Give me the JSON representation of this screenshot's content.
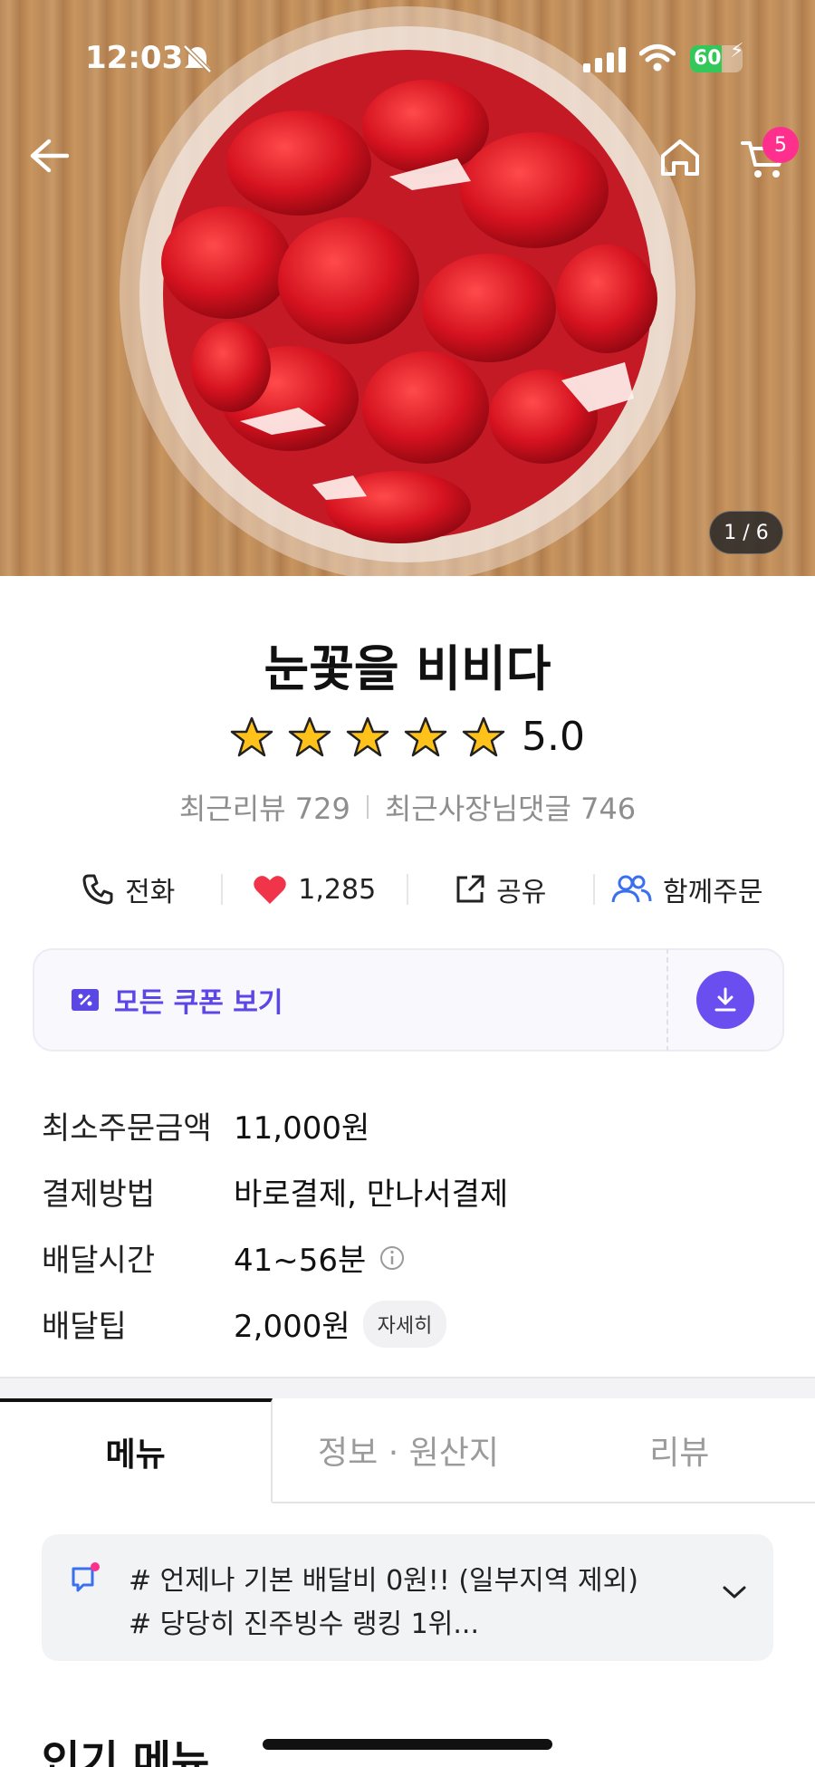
{
  "status_bar": {
    "time": "12:03",
    "battery": "60"
  },
  "hero": {
    "pager": "1 / 6",
    "cart_count": "5"
  },
  "store": {
    "name": "눈꽃을 비비다",
    "rating": "5.0",
    "stars": 5
  },
  "reviews": {
    "recent": "최근리뷰 729",
    "owner": "최근사장님댓글 746"
  },
  "actions": [
    {
      "label": "전화",
      "icon": "phone-icon"
    },
    {
      "label": "1,285",
      "icon": "heart-icon"
    },
    {
      "label": "공유",
      "icon": "share-icon"
    },
    {
      "label": "함께주문",
      "icon": "group-icon"
    }
  ],
  "coupon": {
    "label": "모든 쿠폰 보기"
  },
  "info": {
    "min_order_label": "최소주문금액",
    "min_order_value": "11,000원",
    "payment_label": "결제방법",
    "payment_value": "바로결제, 만나서결제",
    "delivery_time_label": "배달시간",
    "delivery_time_value": "41~56분",
    "delivery_tip_label": "배달팁",
    "delivery_tip_value": "2,000원",
    "detail_chip": "자세히"
  },
  "tabs": [
    "메뉴",
    "정보 · 원산지",
    "리뷰"
  ],
  "notice": {
    "line1": "# 언제나 기본 배달비 0원!! (일부지역 제외)",
    "line2": "# 당당히 진주빙수 랭킹 1위..."
  },
  "section": {
    "title": "인기 메뉴"
  },
  "colors": {
    "accent": "#6a4ef0",
    "heart": "#f0344a",
    "badge": "#ff2f8e"
  }
}
